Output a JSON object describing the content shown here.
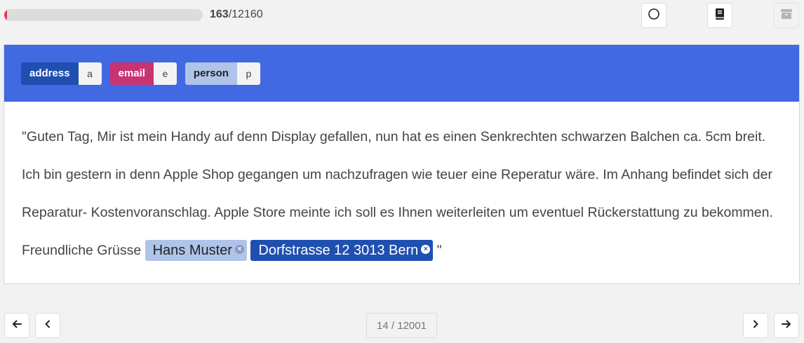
{
  "progress": {
    "done": "163",
    "total": "/12160",
    "fraction": 0.0134,
    "fill_color": "#e8384f"
  },
  "toolbar": {
    "icons": [
      "circle-icon",
      "book-icon",
      "archive-icon"
    ]
  },
  "labels": [
    {
      "name": "address",
      "key": "a",
      "color": "#1f4fb0"
    },
    {
      "name": "email",
      "key": "e",
      "color": "#c83372"
    },
    {
      "name": "person",
      "key": "p",
      "color": "#b0c4ea"
    }
  ],
  "text": {
    "before": "\"Guten Tag, Mir ist mein Handy auf denn Display gefallen, nun hat es einen Senkrechten schwarzen Balchen ca. 5cm breit. Ich bin gestern in denn Apple Shop gegangen um nachzufragen wie teuer eine Reperatur wäre. Im Anhang befindet sich der Reparatur- Kostenvoranschlag. Apple Store meinte ich soll es Ihnen weiterleiten um eventuel Rückerstattung zu bekommen. Freundliche Grüsse ",
    "entities": [
      {
        "text": "Hans Muster",
        "label": "person"
      },
      {
        "text": "Dorfstrasse 12 3013 Bern",
        "label": "address"
      }
    ],
    "after": " \""
  },
  "pagination": {
    "indicator": "14 / 12001"
  },
  "colors": {
    "header": "#4169e1",
    "background": "#f2f2f2"
  }
}
